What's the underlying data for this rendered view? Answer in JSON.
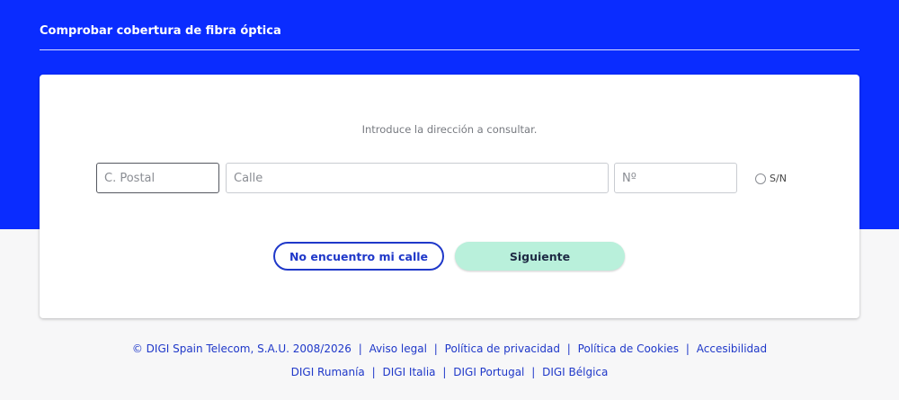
{
  "header": {
    "title": "Comprobar cobertura de fibra óptica"
  },
  "form": {
    "instruction": "Introduce la dirección a consultar.",
    "postal_placeholder": "C. Postal",
    "street_placeholder": "Calle",
    "number_placeholder": "Nº",
    "sn_label": "S/N",
    "no_street_label": "No encuentro mi calle",
    "next_label": "Siguiente"
  },
  "footer": {
    "copyright": "© DIGI Spain Telecom, S.A.U. 2008/2026",
    "separator": "|",
    "legal": "Aviso legal",
    "privacy": "Política de privacidad",
    "cookies": "Política de Cookies",
    "accessibility": "Accesibilidad",
    "romania": "DIGI Rumanía",
    "italy": "DIGI Italia",
    "portugal": "DIGI Portugal",
    "belgium": "DIGI Bélgica"
  },
  "colors": {
    "brand_blue": "#0a2cff",
    "link_blue": "#1f38c9",
    "next_button": "#b9f0db",
    "page_background": "#f7f7f8"
  }
}
